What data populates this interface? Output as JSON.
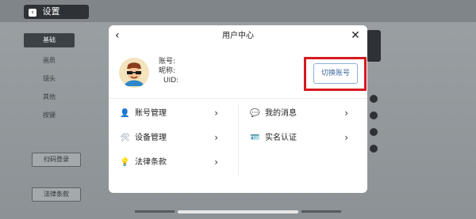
{
  "topbar": {
    "back_label": "设置"
  },
  "sidebar": {
    "items": [
      {
        "label": "基础"
      },
      {
        "label": "画质"
      },
      {
        "label": "镜头"
      },
      {
        "label": "其他"
      },
      {
        "label": "按键"
      }
    ]
  },
  "side_buttons": {
    "scan_login": "扫码登录",
    "legal_terms": "法律条款"
  },
  "modal": {
    "title": "用户中心",
    "account_label": "账号:",
    "nickname_label": "昵称:",
    "uid_label": "UID:",
    "switch_account": "切换账号",
    "menu": [
      {
        "label": "账号管理",
        "icon": "user-icon"
      },
      {
        "label": "我的消息",
        "icon": "message-icon"
      },
      {
        "label": "设备管理",
        "icon": "tools-icon"
      },
      {
        "label": "实名认证",
        "icon": "id-card-icon"
      },
      {
        "label": "法律条款",
        "icon": "lightbulb-icon"
      }
    ]
  }
}
